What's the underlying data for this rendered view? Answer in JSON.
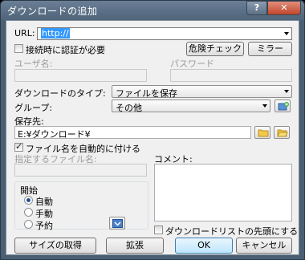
{
  "window": {
    "title": "ダウンロードの追加",
    "help": "?",
    "close": "✕"
  },
  "url": {
    "label": "URL:",
    "value": "http://"
  },
  "auth": {
    "label": "接続時に認証が必要",
    "checked": false
  },
  "buttons": {
    "danger_check": "危険チェック",
    "mirror": "ミラー",
    "size": "サイズの取得",
    "expand": "拡張",
    "ok": "OK",
    "cancel": "キャンセル"
  },
  "user": {
    "label": "ユーザ名:",
    "value": ""
  },
  "password": {
    "label": "パスワード",
    "value": ""
  },
  "download_type": {
    "label": "ダウンロードのタイプ:",
    "value": "ファイルを保存"
  },
  "group": {
    "label": "グループ:",
    "value": "その他"
  },
  "save_to": {
    "label": "保存先:",
    "value": "E:¥ダウンロード¥"
  },
  "auto_name": {
    "label": "ファイル名を自動的に付ける",
    "checked": true
  },
  "filename": {
    "label": "指定するファイル名:",
    "value": ""
  },
  "comment": {
    "label": "コメント:",
    "value": ""
  },
  "start": {
    "label": "開始",
    "options": [
      "自動",
      "手動",
      "予約"
    ],
    "selected": "自動"
  },
  "queue_top": {
    "label": "ダウンロードリストの先頭にする",
    "checked": false
  }
}
